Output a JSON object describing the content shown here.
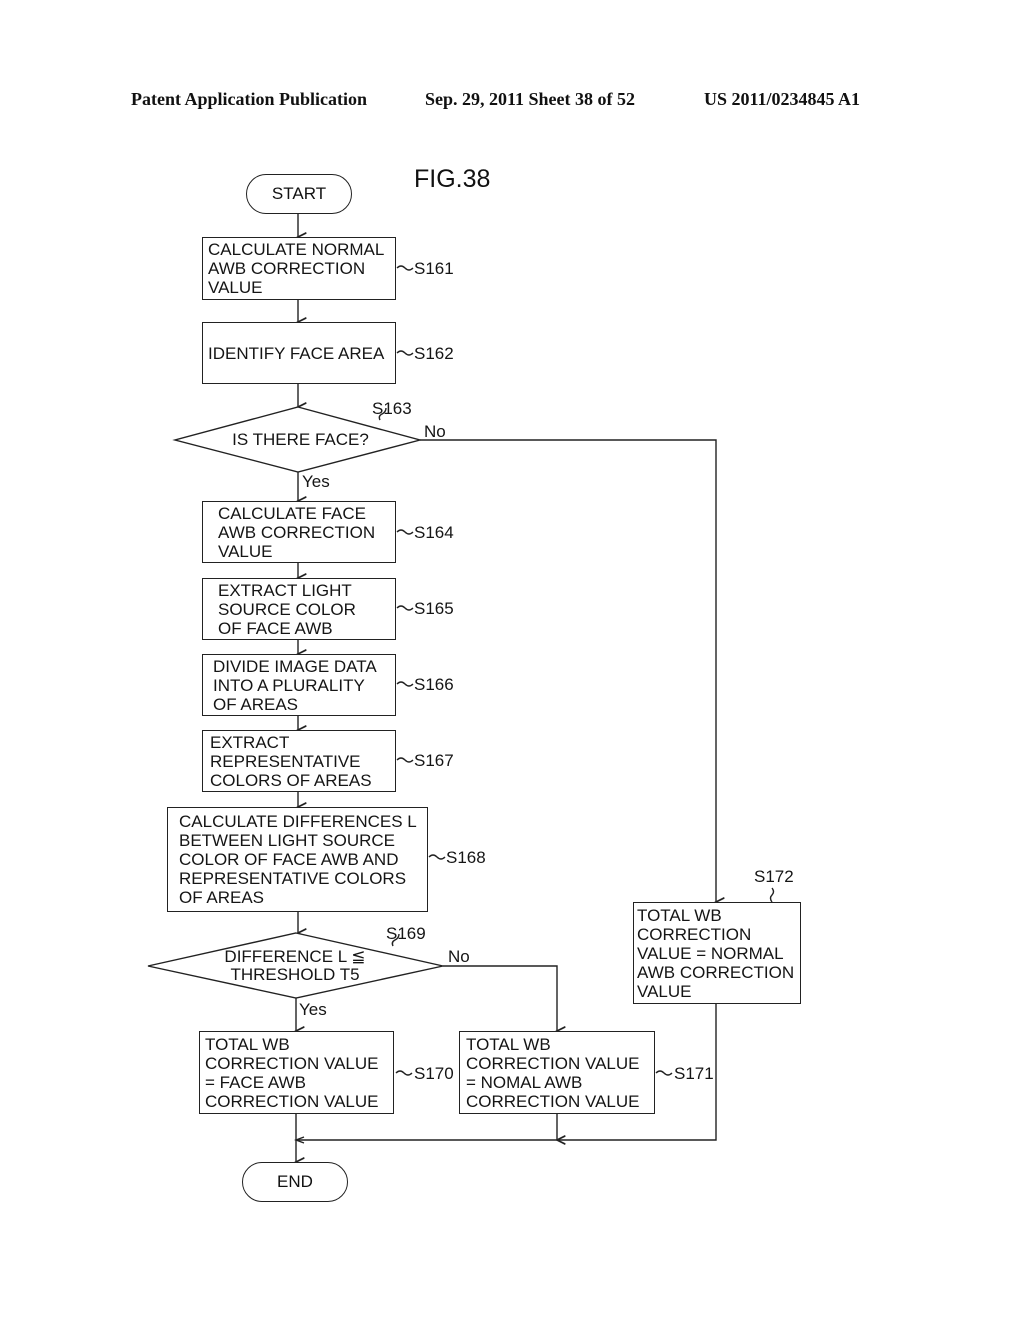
{
  "header": {
    "publication": "Patent Application Publication",
    "date_sheet": "Sep. 29, 2011   Sheet 38 of 52",
    "patent_number": "US 2011/0234845 A1"
  },
  "figure": {
    "title": "FIG.38",
    "start": "START",
    "end": "END",
    "steps": {
      "s161": {
        "id": "S161",
        "text": "CALCULATE NORMAL\nAWB CORRECTION\nVALUE"
      },
      "s162": {
        "id": "S162",
        "text": "IDENTIFY FACE AREA"
      },
      "s163": {
        "id": "S163",
        "text": "IS THERE FACE?",
        "yes": "Yes",
        "no": "No"
      },
      "s164": {
        "id": "S164",
        "text": "CALCULATE FACE\nAWB CORRECTION\nVALUE"
      },
      "s165": {
        "id": "S165",
        "text": "EXTRACT LIGHT\nSOURCE COLOR\nOF FACE AWB"
      },
      "s166": {
        "id": "S166",
        "text": "DIVIDE IMAGE DATA\nINTO A PLURALITY\nOF AREAS"
      },
      "s167": {
        "id": "S167",
        "text": "EXTRACT\nREPRESENTATIVE\nCOLORS OF AREAS"
      },
      "s168": {
        "id": "S168",
        "text": "CALCULATE DIFFERENCES L\nBETWEEN LIGHT SOURCE\nCOLOR OF FACE AWB AND\nREPRESENTATIVE COLORS\nOF AREAS"
      },
      "s169": {
        "id": "S169",
        "text": "DIFFERENCE L ≦\nTHRESHOLD T5",
        "yes": "Yes",
        "no": "No"
      },
      "s170": {
        "id": "S170",
        "text": "TOTAL WB\nCORRECTION VALUE\n= FACE AWB\nCORRECTION VALUE"
      },
      "s171": {
        "id": "S171",
        "text": "TOTAL WB\nCORRECTION VALUE\n= NOMAL AWB\nCORRECTION VALUE"
      },
      "s172": {
        "id": "S172",
        "text": "TOTAL WB\nCORRECTION\nVALUE = NORMAL\nAWB CORRECTION\nVALUE"
      }
    }
  }
}
